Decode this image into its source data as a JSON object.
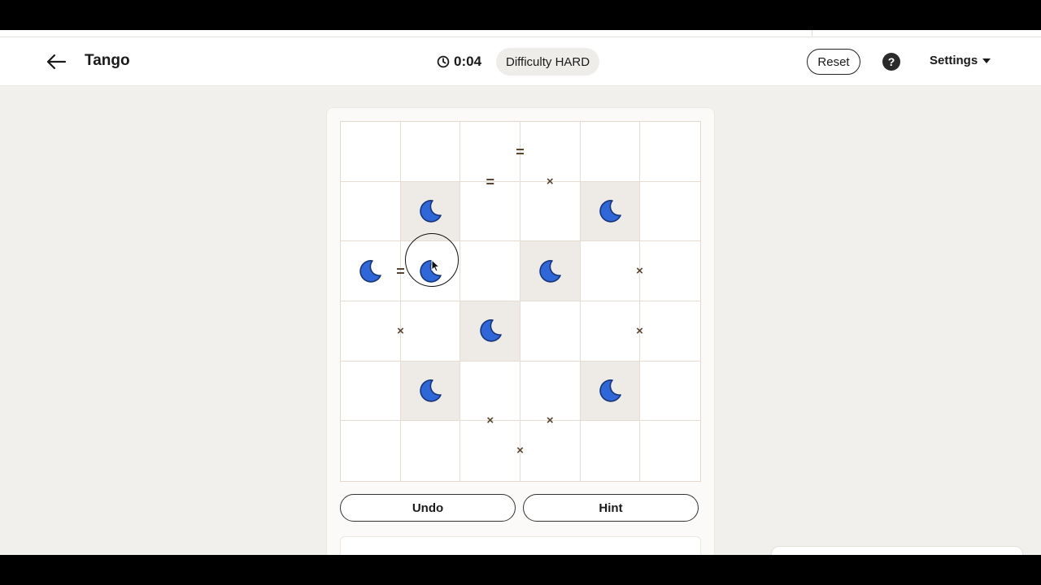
{
  "header": {
    "title": "Tango",
    "timer": "0:04",
    "difficulty": "Difficulty HARD",
    "reset_label": "Reset",
    "help_label": "?",
    "settings_label": "Settings"
  },
  "board": {
    "rows": 6,
    "cols": 6,
    "cells": [
      [
        "",
        "",
        "",
        "",
        "",
        ""
      ],
      [
        "",
        "moon",
        "",
        "",
        "moon",
        ""
      ],
      [
        "moon",
        "moon",
        "",
        "moon",
        "",
        ""
      ],
      [
        "",
        "",
        "moon",
        "",
        "",
        ""
      ],
      [
        "",
        "moon",
        "",
        "",
        "moon",
        ""
      ],
      [
        "",
        "",
        "",
        "",
        "",
        ""
      ]
    ],
    "locked": [
      [
        false,
        false,
        false,
        false,
        false,
        false
      ],
      [
        false,
        true,
        false,
        false,
        true,
        false
      ],
      [
        false,
        false,
        false,
        true,
        false,
        false
      ],
      [
        false,
        false,
        true,
        false,
        false,
        false
      ],
      [
        false,
        true,
        false,
        false,
        true,
        false
      ],
      [
        false,
        false,
        false,
        false,
        false,
        false
      ]
    ],
    "constraints": [
      {
        "symbol": "=",
        "between": [
          [
            0,
            2
          ],
          [
            0,
            3
          ]
        ]
      },
      {
        "symbol": "=",
        "between": [
          [
            0,
            2
          ],
          [
            1,
            2
          ]
        ]
      },
      {
        "symbol": "×",
        "between": [
          [
            0,
            3
          ],
          [
            1,
            3
          ]
        ]
      },
      {
        "symbol": "=",
        "between": [
          [
            2,
            0
          ],
          [
            2,
            1
          ]
        ]
      },
      {
        "symbol": "×",
        "between": [
          [
            2,
            4
          ],
          [
            2,
            5
          ]
        ]
      },
      {
        "symbol": "×",
        "between": [
          [
            3,
            0
          ],
          [
            3,
            1
          ]
        ]
      },
      {
        "symbol": "×",
        "between": [
          [
            3,
            4
          ],
          [
            3,
            5
          ]
        ]
      },
      {
        "symbol": "×",
        "between": [
          [
            4,
            2
          ],
          [
            5,
            2
          ]
        ]
      },
      {
        "symbol": "×",
        "between": [
          [
            4,
            3
          ],
          [
            5,
            3
          ]
        ]
      },
      {
        "symbol": "×",
        "between": [
          [
            5,
            2
          ],
          [
            5,
            3
          ]
        ]
      }
    ]
  },
  "actions": {
    "undo_label": "Undo",
    "hint_label": "Hint"
  },
  "colors": {
    "moon_fill": "#2f67d8",
    "moon_stroke": "#16357a",
    "locked_cell": "#eeeae5",
    "background": "#f2f0ec"
  }
}
